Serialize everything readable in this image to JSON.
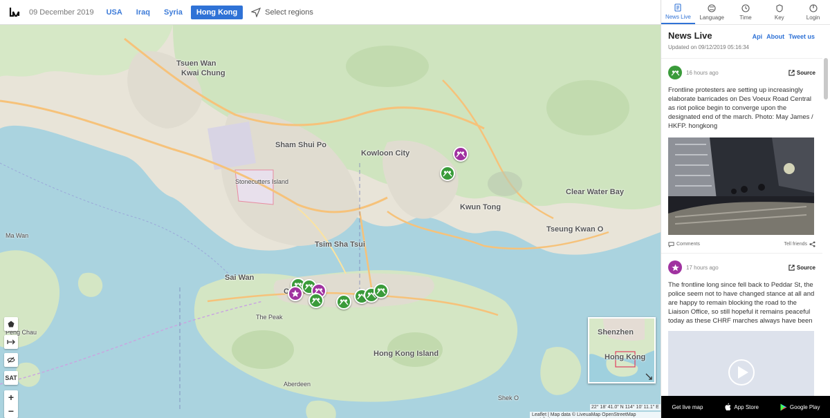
{
  "header": {
    "date": "09 December 2019",
    "regions": [
      {
        "label": "USA",
        "active": false
      },
      {
        "label": "Iraq",
        "active": false
      },
      {
        "label": "Syria",
        "active": false
      },
      {
        "label": "Hong Kong",
        "active": true
      }
    ],
    "select_regions": "Select regions"
  },
  "panel": {
    "nav": [
      {
        "label": "News Live",
        "icon": "news-icon",
        "active": true
      },
      {
        "label": "Language",
        "icon": "language-icon",
        "active": false
      },
      {
        "label": "Time",
        "icon": "clock-icon",
        "active": false
      },
      {
        "label": "Key",
        "icon": "key-icon",
        "active": false
      },
      {
        "label": "Login",
        "icon": "login-icon",
        "active": false
      }
    ],
    "title": "News Live",
    "updated": "Updated on 09/12/2019 05:16:34",
    "links": {
      "api": "Api",
      "about": "About",
      "tweet": "Tweet us"
    },
    "posts": [
      {
        "time": "16 hours ago",
        "source": "Source",
        "icon": "protest-icon",
        "color": "#3a9b3a",
        "text": "Frontline protesters are setting up increasingly elaborate barricades on Des Voeux Road Central as riot police begin to converge upon the designated end of the march. Photo: May James / HKFP. hongkong",
        "comments": "Comments",
        "tell": "Tell friends"
      },
      {
        "time": "17 hours ago",
        "source": "Source",
        "icon": "star-icon",
        "color": "#a032a0",
        "text": "The frontline long since fell back to Peddar St, the police seem not to have changed stance at all and are happy to remain blocking the road to the Liaison Office, so still hopeful it remains peaceful today as these CHRF marches always have been"
      }
    ],
    "bottom": {
      "live": "Get live map",
      "appstore": "App Store",
      "google": "Google Play"
    }
  },
  "map": {
    "labels": {
      "tsuen_wan": "Tsuen Wan",
      "kwai_chung": "Kwai Chung",
      "sham_shui_po": "Sham Shui Po",
      "kowloon_city": "Kowloon City",
      "tsim_sha_tsui": "Tsim Sha Tsui",
      "kwun_tong": "Kwun Tong",
      "tseung_kwan_o": "Tseung Kwan O",
      "sai_wan": "Sai Wan",
      "central": "Central",
      "the_peak": "The Peak",
      "hong_kong_island": "Hong Kong Island",
      "clear_water_bay": "Clear Water Bay",
      "aberdeen": "Aberdeen",
      "shek_o": "Shek O",
      "stonecutters": "Stonecutters Island",
      "ma_wan": "Ma Wan",
      "peng_chau": "Peng Chau"
    },
    "tools": {
      "sat": "SAT",
      "zoom_in": "+",
      "zoom_out": "−"
    },
    "minimap": {
      "shenzhen": "Shenzhen",
      "hong_kong": "Hong Kong"
    },
    "coords": "22° 18' 41.0\" N  114° 10' 11.1\" E",
    "attribution": "Leaflet | Map data © LiveuaMap OpenStreetMap contributors"
  }
}
